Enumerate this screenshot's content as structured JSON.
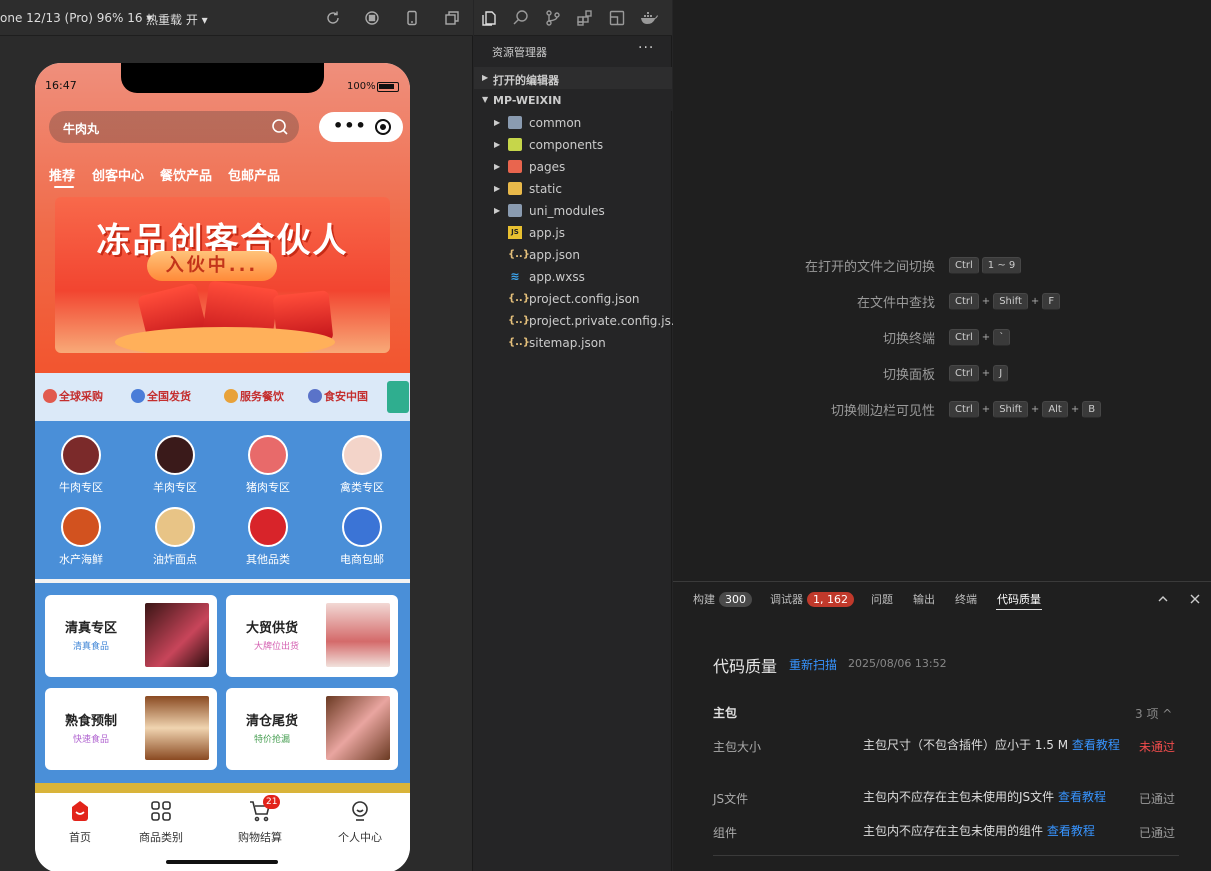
{
  "simulator": {
    "device_label": "one 12/13 (Pro) 96% 16 ▾",
    "hot_reload_label": "热重载 开 ▾",
    "status": {
      "time": "16:47",
      "battery": "100%"
    },
    "search": {
      "text": "牛肉丸"
    },
    "header_tabs": [
      "推荐",
      "创客中心",
      "餐饮产品",
      "包邮产品"
    ],
    "banner": {
      "title": "冻品创客合伙人",
      "pill": "入伙中..."
    },
    "features": [
      "全球采购",
      "全国发货",
      "服务餐饮",
      "食安中国"
    ],
    "categories": [
      {
        "label": "牛肉专区"
      },
      {
        "label": "羊肉专区"
      },
      {
        "label": "猪肉专区"
      },
      {
        "label": "禽类专区"
      },
      {
        "label": "水产海鲜"
      },
      {
        "label": "油炸面点"
      },
      {
        "label": "其他品类"
      },
      {
        "label": "电商包邮"
      }
    ],
    "promos": [
      {
        "title": "清真专区",
        "subtitle": "清真食品",
        "sub_color": "#3f85d6"
      },
      {
        "title": "大贸供货",
        "subtitle": "大牌位出货",
        "sub_color": "#d45fb1"
      },
      {
        "title": "熟食预制",
        "subtitle": "快速食品",
        "sub_color": "#b063d0"
      },
      {
        "title": "清仓尾货",
        "subtitle": "特价抢漏",
        "sub_color": "#4aa055"
      }
    ],
    "tabbar": [
      {
        "label": "首页"
      },
      {
        "label": "商品类别"
      },
      {
        "label": "购物结算"
      },
      {
        "label": "个人中心"
      }
    ],
    "cart_badge": "21"
  },
  "explorer": {
    "title": "资源管理器",
    "more": "···",
    "open_editors": "打开的编辑器",
    "project": "MP-WEIXIN",
    "folders": [
      {
        "name": "common",
        "color": "#8a9bb0"
      },
      {
        "name": "components",
        "color": "#c6d64a"
      },
      {
        "name": "pages",
        "color": "#e9654e"
      },
      {
        "name": "static",
        "color": "#e9b94a"
      },
      {
        "name": "uni_modules",
        "color": "#8a9bb0"
      }
    ],
    "files": [
      {
        "name": "app.js",
        "icon": "js"
      },
      {
        "name": "app.json",
        "icon": "{..}"
      },
      {
        "name": "app.wxss",
        "icon": "css"
      },
      {
        "name": "project.config.json",
        "icon": "{..}"
      },
      {
        "name": "project.private.config.js...",
        "icon": "{..}"
      },
      {
        "name": "sitemap.json",
        "icon": "{..}"
      }
    ]
  },
  "shortcuts": [
    {
      "label": "在打开的文件之间切换",
      "keys": [
        "Ctrl",
        "1 ~ 9"
      ],
      "sep": ""
    },
    {
      "label": "在文件中查找",
      "keys": [
        "Ctrl",
        "Shift",
        "F"
      ],
      "sep": "+"
    },
    {
      "label": "切换终端",
      "keys": [
        "Ctrl",
        "`"
      ],
      "sep": "+"
    },
    {
      "label": "切换面板",
      "keys": [
        "Ctrl",
        "J"
      ],
      "sep": "+"
    },
    {
      "label": "切换侧边栏可见性",
      "keys": [
        "Ctrl",
        "Shift",
        "Alt",
        "B"
      ],
      "sep": "+"
    }
  ],
  "panel": {
    "tabs": [
      {
        "label": "构建",
        "badge": "300",
        "badge_color": "#4a4a4a"
      },
      {
        "label": "调试器",
        "badge": "1, 162",
        "badge_color": "#c0392b"
      },
      {
        "label": "问题",
        "badge": "",
        "badge_color": ""
      },
      {
        "label": "输出",
        "badge": "",
        "badge_color": ""
      },
      {
        "label": "终端",
        "badge": "",
        "badge_color": ""
      },
      {
        "label": "代码质量",
        "badge": "",
        "badge_color": ""
      }
    ],
    "active_tab": "代码质量",
    "code_quality": {
      "title": "代码质量",
      "rescan": "重新扫描",
      "date": "2025/08/06 13:52",
      "section": "主包",
      "count": "3 项 ^",
      "rows": [
        {
          "name": "主包大小",
          "desc": "主包尺寸（不包含插件）应小于 1.5 M ",
          "link": "查看教程",
          "result": "未通过",
          "result_color": "#f14c4c"
        },
        {
          "name": "JS文件",
          "desc": "主包内不应存在主包未使用的JS文件 ",
          "link": "查看教程",
          "result": "已通过",
          "result_color": "#9a9a9a"
        },
        {
          "name": "组件",
          "desc": "主包内不应存在主包未使用的组件 ",
          "link": "查看教程",
          "result": "已通过",
          "result_color": "#9a9a9a"
        }
      ]
    }
  }
}
